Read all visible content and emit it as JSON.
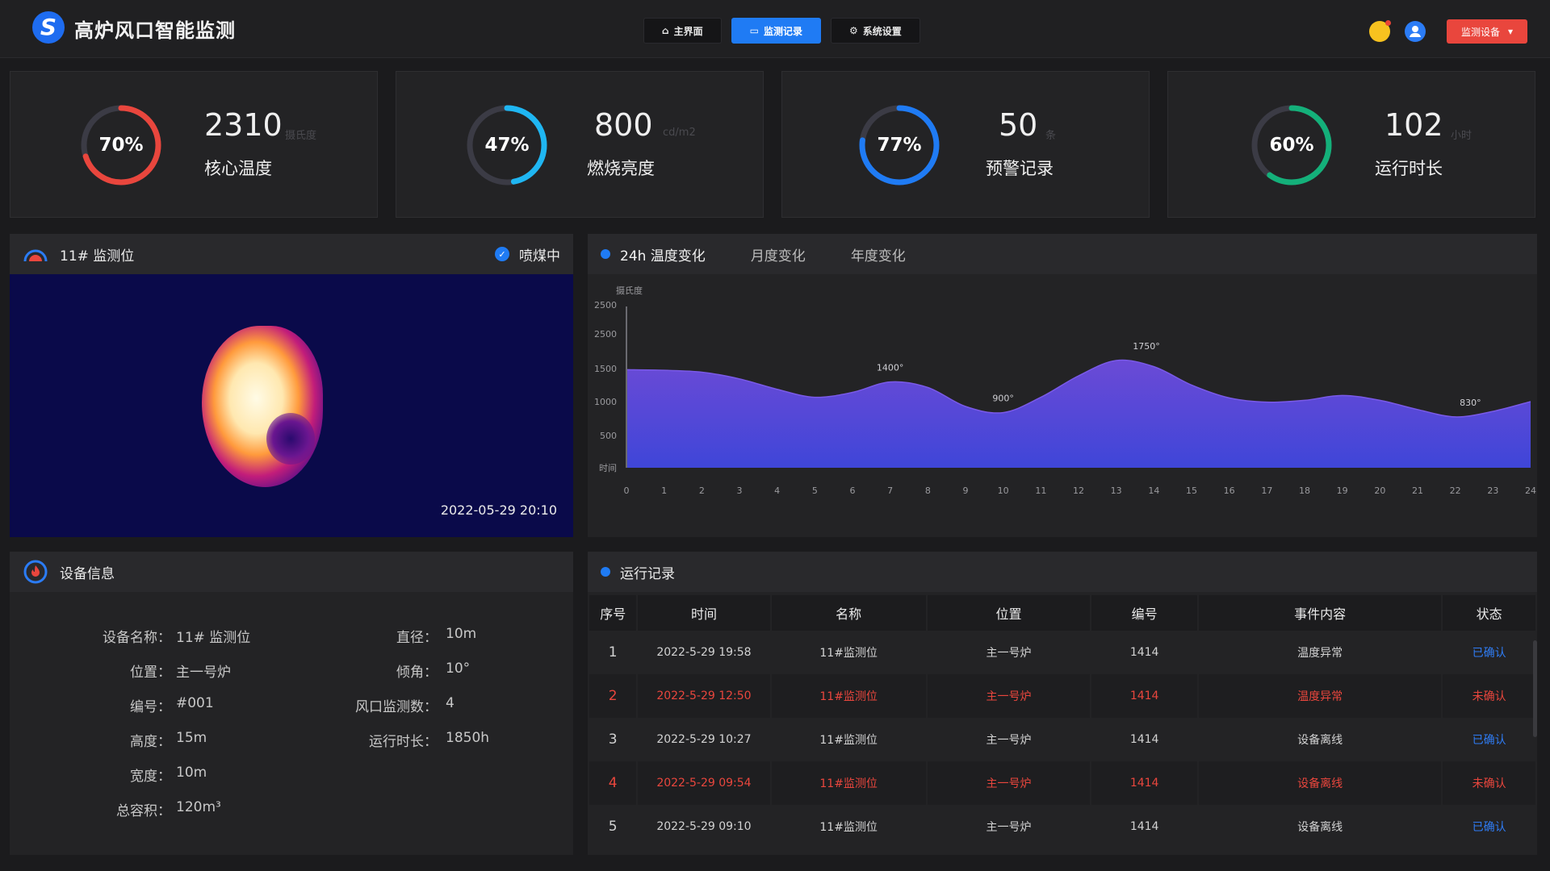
{
  "header": {
    "logo_letter": "S",
    "title": "高炉风口智能监测",
    "nav": [
      {
        "label": "主界面",
        "icon": "home-icon"
      },
      {
        "label": "监测记录",
        "icon": "monitor-icon",
        "active": true
      },
      {
        "label": "系统设置",
        "icon": "gear-icon"
      }
    ],
    "device_button": "监测设备"
  },
  "kpis": [
    {
      "pct_label": "70%",
      "pct": 0.7,
      "color": "#e9463d",
      "value": "2310",
      "unit": "摄氏度",
      "label": "核心温度"
    },
    {
      "pct_label": "47%",
      "pct": 0.47,
      "color": "#1fb6f2",
      "value": "800",
      "unit": "cd/m2",
      "label": "燃烧亮度"
    },
    {
      "pct_label": "77%",
      "pct": 0.77,
      "color": "#1f7bf4",
      "value": "50",
      "unit": "条",
      "label": "预警记录"
    },
    {
      "pct_label": "60%",
      "pct": 0.6,
      "color": "#14b07a",
      "value": "102",
      "unit": "小时",
      "label": "运行时长"
    }
  ],
  "camera": {
    "title": "11# 监测位",
    "status": "喷煤中",
    "timestamp": "2022-05-29  20:10"
  },
  "chart_tabs": [
    "24h 温度变化",
    "月度变化",
    "年度变化"
  ],
  "chart_data": {
    "type": "area",
    "title": "",
    "ylabel": "摄氏度",
    "xlabel": "",
    "y_ticks": [
      "时间",
      "500",
      "1000",
      "1500",
      "2500",
      "2500"
    ],
    "x": [
      0,
      1,
      2,
      3,
      4,
      5,
      6,
      7,
      8,
      9,
      10,
      11,
      12,
      13,
      14,
      15,
      16,
      17,
      18,
      19,
      20,
      21,
      22,
      23,
      24
    ],
    "values": [
      1600,
      1590,
      1560,
      1450,
      1280,
      1150,
      1230,
      1400,
      1310,
      1000,
      900,
      1150,
      1500,
      1750,
      1650,
      1350,
      1140,
      1070,
      1100,
      1180,
      1100,
      950,
      830,
      920,
      1080
    ],
    "annotations": [
      {
        "x": 7,
        "y": 1400,
        "text": "1400°"
      },
      {
        "x": 10,
        "y": 900,
        "text": "900°"
      },
      {
        "x": 13.8,
        "y": 1750,
        "text": "1750°"
      },
      {
        "x": 22.4,
        "y": 830,
        "text": "830°"
      }
    ],
    "color_top": "#6b4ad6",
    "color_bottom": "#3f46d8"
  },
  "device": {
    "title": "设备信息",
    "left": [
      {
        "k": "设备名称：",
        "v": "11# 监测位"
      },
      {
        "k": "位置：",
        "v": "主一号炉"
      },
      {
        "k": "编号：",
        "v": "#001"
      },
      {
        "k": "高度：",
        "v": "15m"
      },
      {
        "k": "宽度：",
        "v": "10m"
      },
      {
        "k": "总容积：",
        "v": "120m³"
      }
    ],
    "right": [
      {
        "k": "直径：",
        "v": "10m"
      },
      {
        "k": "倾角：",
        "v": "10°"
      },
      {
        "k": "风口监测数：",
        "v": "4"
      },
      {
        "k": "运行时长：",
        "v": "1850h"
      }
    ]
  },
  "records": {
    "title": "运行记录",
    "columns": [
      "序号",
      "时间",
      "名称",
      "位置",
      "编号",
      "事件内容",
      "状态"
    ],
    "rows": [
      {
        "no": "1",
        "time": "2022-5-29 19:58",
        "name": "11#监测位",
        "loc": "主一号炉",
        "code": "1414",
        "event": "温度异常",
        "status": "已确认",
        "warn": false
      },
      {
        "no": "2",
        "time": "2022-5-29 12:50",
        "name": "11#监测位",
        "loc": "主一号炉",
        "code": "1414",
        "event": "温度异常",
        "status": "未确认",
        "warn": true
      },
      {
        "no": "3",
        "time": "2022-5-29 10:27",
        "name": "11#监测位",
        "loc": "主一号炉",
        "code": "1414",
        "event": "设备离线",
        "status": "已确认",
        "warn": false
      },
      {
        "no": "4",
        "time": "2022-5-29 09:54",
        "name": "11#监测位",
        "loc": "主一号炉",
        "code": "1414",
        "event": "设备离线",
        "status": "未确认",
        "warn": true
      },
      {
        "no": "5",
        "time": "2022-5-29 09:10",
        "name": "11#监测位",
        "loc": "主一号炉",
        "code": "1414",
        "event": "设备离线",
        "status": "已确认",
        "warn": false
      }
    ]
  }
}
